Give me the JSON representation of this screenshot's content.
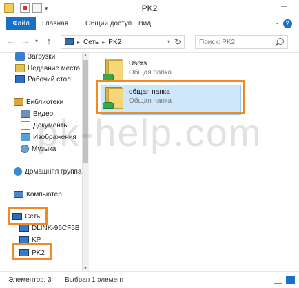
{
  "window": {
    "title": "PK2"
  },
  "ribbon": {
    "tabs": [
      "Файл",
      "Главная",
      "Общий доступ",
      "Вид"
    ],
    "help": "?"
  },
  "nav": {
    "back": "←",
    "forward": "→",
    "history": "▾",
    "up": "↑",
    "breadcrumb": [
      "Сеть",
      "PK2"
    ],
    "crumb_sep": "▸"
  },
  "search": {
    "placeholder": "Поиск: PK2"
  },
  "sidebar": {
    "favorites": [
      "Загрузки",
      "Недавние места",
      "Рабочий стол"
    ],
    "libraries": {
      "label": "Библиотеки",
      "items": [
        "Видео",
        "Документы",
        "Изображения",
        "Музыка"
      ]
    },
    "homegroup": "Домашняя группа",
    "computer": "Компьютер",
    "network": {
      "label": "Сеть",
      "items": [
        "DLINK-96CF5B",
        "KP",
        "PK2"
      ]
    }
  },
  "files": [
    {
      "name": "Users",
      "type": "Общая папка"
    },
    {
      "name": "общая папка",
      "type": "Общая папка"
    }
  ],
  "watermark": "pk-help.com",
  "status": {
    "count": "Элементов: 3",
    "selected": "Выбран 1 элемент"
  },
  "colors": {
    "accent": "#1a6fc7",
    "highlight": "#f08a25",
    "selection": "#cfe7fa"
  }
}
